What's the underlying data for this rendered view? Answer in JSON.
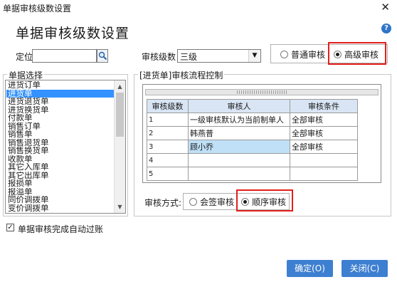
{
  "window": {
    "title": "单据审核级数设置",
    "close_glyph": "✕"
  },
  "dialog": {
    "heading": "单据审核级数设置",
    "help_glyph": "?"
  },
  "locate": {
    "label": "定位",
    "value": ""
  },
  "level": {
    "label": "审核级数",
    "value": "三级"
  },
  "mode": {
    "normal_label": "普通审核",
    "advanced_label": "高级审核",
    "selected": "高级审核"
  },
  "doc_select": {
    "label": "单据选择",
    "items": [
      "进货订单",
      "进货单",
      "进货退货单",
      "进货换货单",
      "付款单",
      "销售订单",
      "销售单",
      "销售退货单",
      "销售换货单",
      "收款单",
      "其它入库单",
      "其它出库单",
      "报损单",
      "报溢单",
      "同价调拨单",
      "变价调拨单"
    ],
    "selected": "进货单"
  },
  "flow": {
    "label": "[进货单]审核流程控制",
    "headers": [
      "审核级数",
      "审核人",
      "审核条件"
    ],
    "rows": [
      [
        "1",
        "一级审核默认为当前制单人",
        "全部审核"
      ],
      [
        "2",
        "韩燕普",
        "全部审核"
      ],
      [
        "3",
        "顾小乔",
        "全部审核"
      ],
      [
        "4",
        "",
        ""
      ],
      [
        "5",
        "",
        ""
      ]
    ]
  },
  "method": {
    "label": "审核方式:",
    "cosign_label": "会签审核",
    "sequential_label": "顺序审核",
    "selected": "顺序审核"
  },
  "auto_post": {
    "label": "单据审核完成自动过账",
    "checked": true
  },
  "buttons": {
    "ok": "确定(O)",
    "close": "关闭(C)"
  },
  "colors": {
    "accent": "#3d7fd0",
    "highlight": "#e1201a",
    "selection": "#3392ff"
  },
  "icons": {
    "locate": "search-icon",
    "help": "help-icon"
  }
}
